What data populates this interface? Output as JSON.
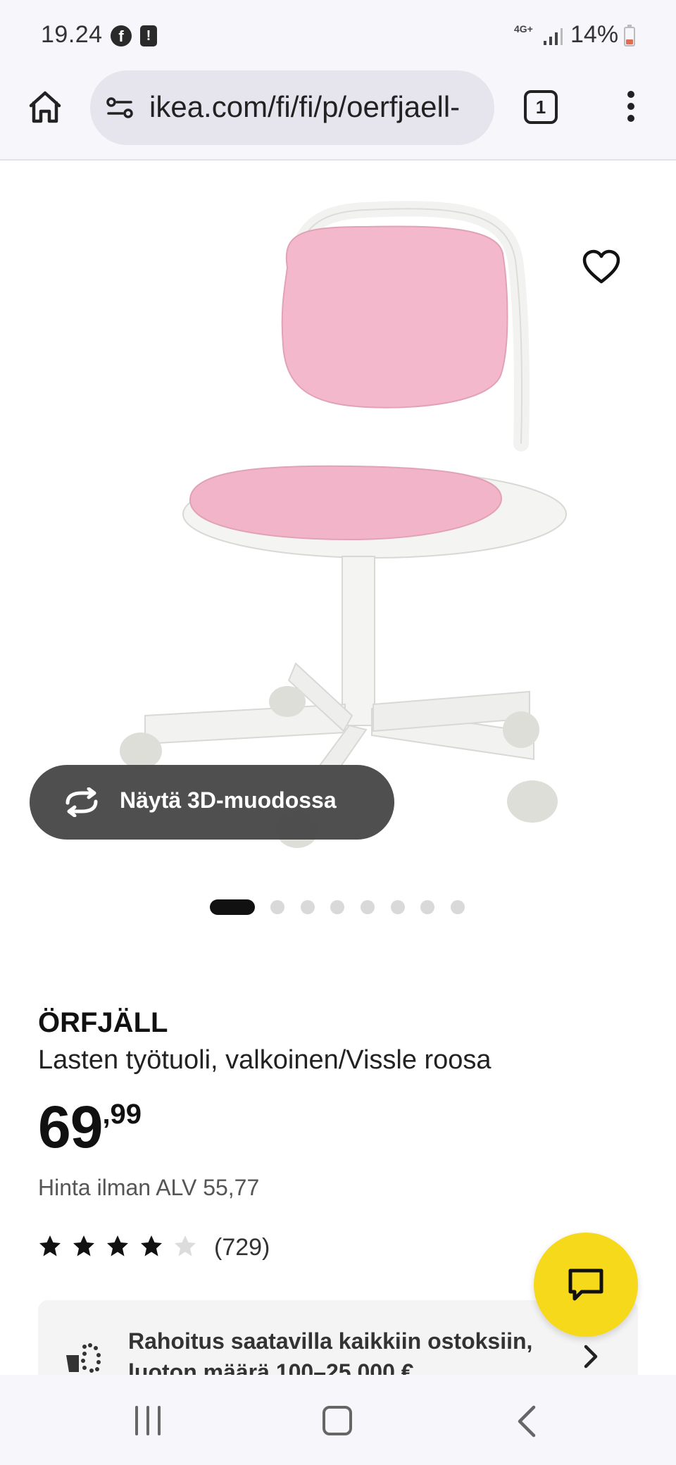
{
  "status_bar": {
    "time": "19.24",
    "network": "4G+",
    "battery_percent": "14%",
    "notification_icons": [
      "facebook-icon",
      "alert-icon"
    ]
  },
  "browser": {
    "url": "ikea.com/fi/fi/p/oerfjaell-",
    "tab_count": "1",
    "icons": [
      "home-icon",
      "site-settings-icon",
      "tab-switcher-icon",
      "more-menu-icon"
    ]
  },
  "gallery": {
    "view_3d_label": "Näytä 3D-muodossa",
    "image_count": 8,
    "active_image": 1,
    "favorite_icon": "heart-outline-icon"
  },
  "product": {
    "name": "ÖRFJÄLL",
    "description": "Lasten työtuoli, valkoinen/Vissle roosa",
    "price_integer": "69",
    "price_decimal": ",99",
    "price_vat_text": "Hinta ilman ALV 55,77",
    "rating_value": 4,
    "rating_max": 5,
    "review_count": "(729)"
  },
  "financing": {
    "text": "Rahoitus saatavilla kaikkiin ostoksiin, luoton määrä 100–25 000 €"
  },
  "colors": {
    "chat_fab": "#f7d91b",
    "text_primary": "#111111",
    "chair_pink": "#f0b5c8",
    "overlay_button": "#484848"
  }
}
